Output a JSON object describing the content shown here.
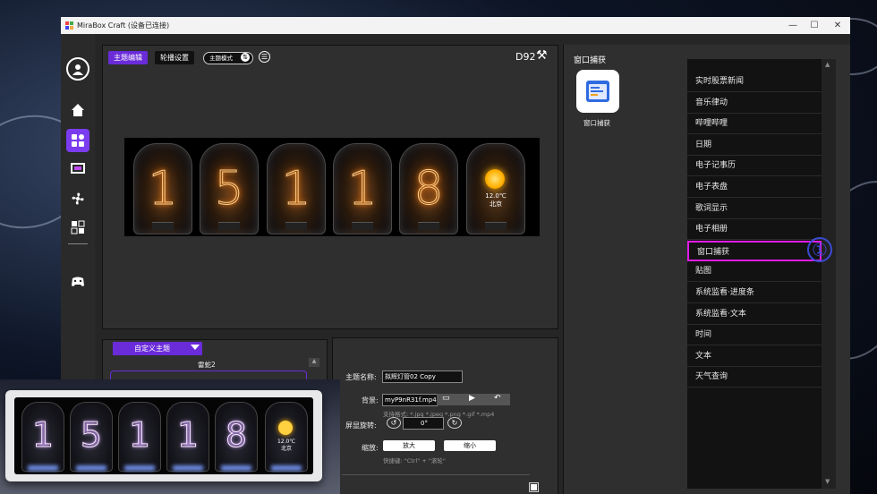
{
  "window": {
    "title": "MiraBox Craft   (设备已连接)",
    "controls": [
      "—",
      "☐",
      "✕"
    ]
  },
  "preview": {
    "tabs": [
      "主题编辑",
      "轮播设置"
    ],
    "mode_label": "主题模式",
    "device_name": "D92",
    "digits": [
      "1",
      "5",
      "1",
      "1",
      "8"
    ],
    "weather": {
      "temp": "12.0℃",
      "city": "北京"
    }
  },
  "theme_panel": {
    "dropdown_value": "自定义主题",
    "theme_item": "雷蛇2"
  },
  "settings": {
    "name_label": "主题名称:",
    "name_value": "拟辉灯管02 Copy",
    "bg_label": "背景:",
    "bg_value": "myP9nR31f.mp4",
    "bg_hint": "支持格式: *.jpg *.jpeg *.png *.gif *.mp4",
    "rotate_label": "屏显旋转:",
    "rotate_value": "0°",
    "zoom_label": "缩放:",
    "zoom_in": "放大",
    "zoom_out": "缩小",
    "zoom_hint": "快捷键: \"Ctrl\" + \"滚轮\""
  },
  "widget_panel": {
    "title": "窗口捕获",
    "tile_label": "窗口捕获",
    "items": [
      "实时股票新闻",
      "音乐律动",
      "哔哩哔哩",
      "日期",
      "电子记事历",
      "电子表盘",
      "歌词显示",
      "电子相册",
      "窗口捕获",
      "贴图",
      "系统监看·进度条",
      "系统监看·文本",
      "时间",
      "文本",
      "天气查询"
    ],
    "selected_index": 8,
    "annotation": "①"
  },
  "device_photo": {
    "digits": [
      "1",
      "5",
      "1",
      "1",
      "8"
    ],
    "weather_temp": "12.0℃",
    "weather_city": "北京"
  },
  "colors": {
    "accent": "#6a2bd8",
    "selection": "#e11be8",
    "annotation": "#3b4bd0"
  }
}
